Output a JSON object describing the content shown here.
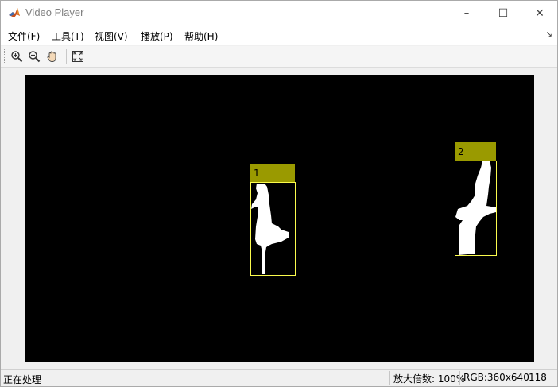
{
  "window": {
    "title": "Video Player",
    "controls": {
      "minimize": "–",
      "maximize": "☐",
      "close": "✕"
    }
  },
  "menu": {
    "items": [
      "文件(F)",
      "工具(T)",
      "视图(V)",
      "播放(P)",
      "帮助(H)"
    ],
    "overflow_arrow": "↘"
  },
  "toolbar": {
    "buttons": [
      "zoom-in-icon",
      "zoom-out-icon",
      "pan-hand-icon",
      "fit-to-window-icon"
    ]
  },
  "video": {
    "resolution": [
      640,
      360
    ],
    "background": "#000000",
    "box_color": "#fbfb4d",
    "label_fill": "#9a9a00",
    "blob_color": "#ffffff",
    "detections": [
      {
        "label": "1"
      },
      {
        "label": "2"
      }
    ]
  },
  "status": {
    "left_text": "正在处理",
    "zoom": "放大倍数: 100%",
    "rgb": "RGB:360x640",
    "frame": "118"
  }
}
